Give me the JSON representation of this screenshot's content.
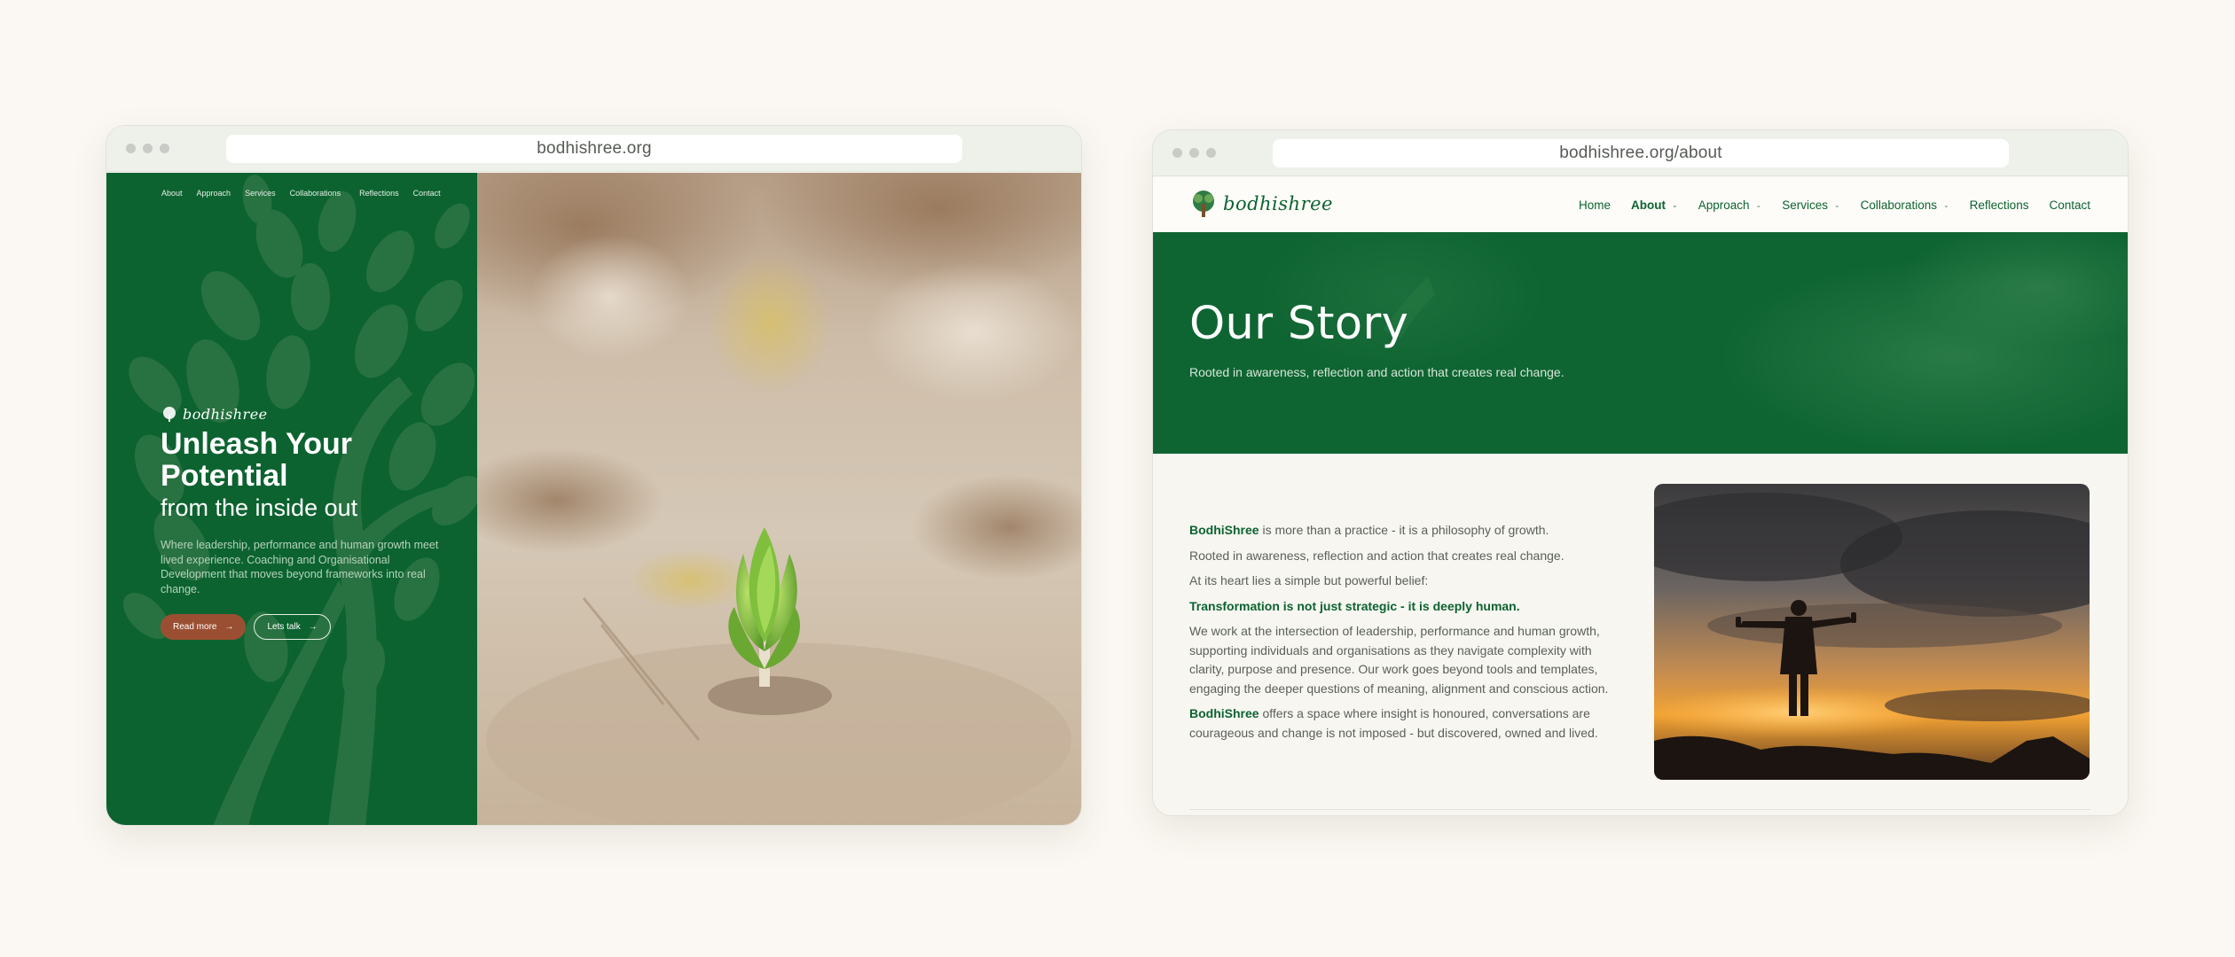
{
  "home_browser": {
    "url": "bodhishree.org",
    "nav": [
      "About",
      "Approach",
      "Services",
      "Collaborations",
      "Reflections",
      "Contact"
    ],
    "logo_text": "bodhishree",
    "headline": "Unleash Your Potential",
    "subheadline": "from the inside out",
    "description": "Where leadership, performance and human growth meet lived experience. Coaching and Organisational Development that moves beyond frameworks into real change.",
    "primary_button": "Read more",
    "secondary_button": "Lets talk",
    "colors": {
      "brand_green": "#0c6330",
      "button_brown": "#9b4f32"
    }
  },
  "about_browser": {
    "url": "bodhishree.org/about",
    "logo_text": "bodhishree",
    "nav": {
      "home": "Home",
      "about": "About",
      "approach": "Approach",
      "services": "Services",
      "collaborations": "Collaborations",
      "reflections": "Reflections",
      "contact": "Contact"
    },
    "banner": {
      "title": "Our Story",
      "subtitle": "Rooted in awareness, reflection and action that creates real change."
    },
    "body": {
      "p1_brand": "BodhiShree",
      "p1_rest": " is more than a practice - it is a philosophy of growth.",
      "p2": "Rooted in awareness, reflection and action that creates real change.",
      "p3": "At its heart lies a simple but powerful belief:",
      "p4": "Transformation is not just strategic - it is deeply human.",
      "p5": "We work at the intersection of leadership, performance and human growth, supporting individuals and organisations as they navigate complexity with clarity, purpose and presence. Our work goes beyond tools and templates, engaging the deeper questions of meaning, alignment and conscious action.",
      "p6_brand": "BodhiShree",
      "p6_rest": " offers a space where insight is honoured, conversations are courageous and change is not imposed - but discovered, owned and lived."
    }
  }
}
